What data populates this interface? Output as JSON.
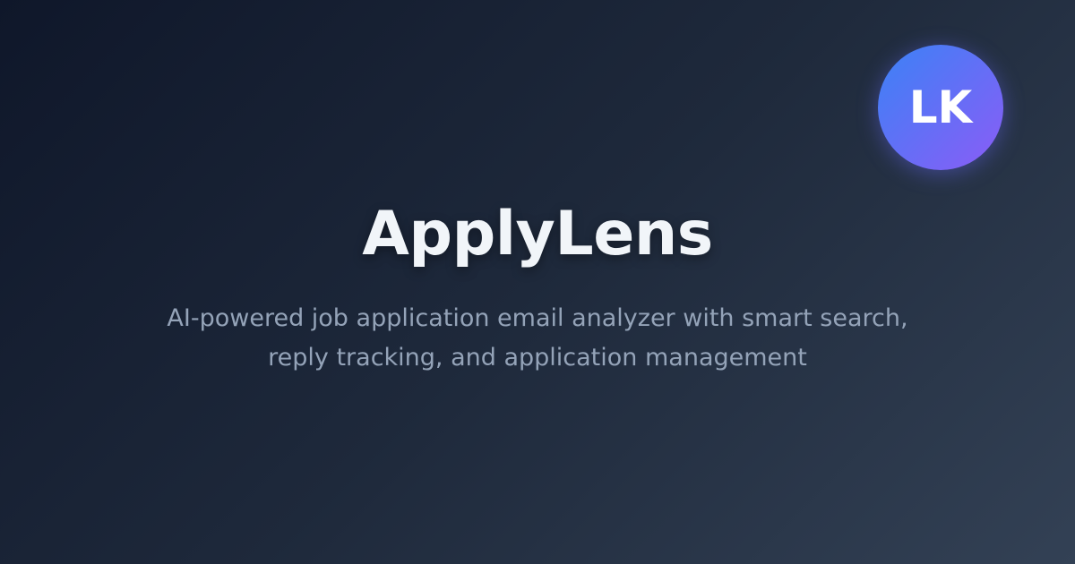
{
  "brand": {
    "avatar_initials": "LK",
    "title": "ApplyLens",
    "tagline_line1": "AI-powered job application email analyzer with smart search,",
    "tagline_line2": "reply tracking, and application management"
  },
  "colors": {
    "background_start": "#0f172a",
    "background_end": "#334155",
    "avatar_gradient_start": "#3b82f6",
    "avatar_gradient_end": "#8b5cf6",
    "title_text": "#f1f5f9",
    "tagline_text": "#94a3b8"
  }
}
